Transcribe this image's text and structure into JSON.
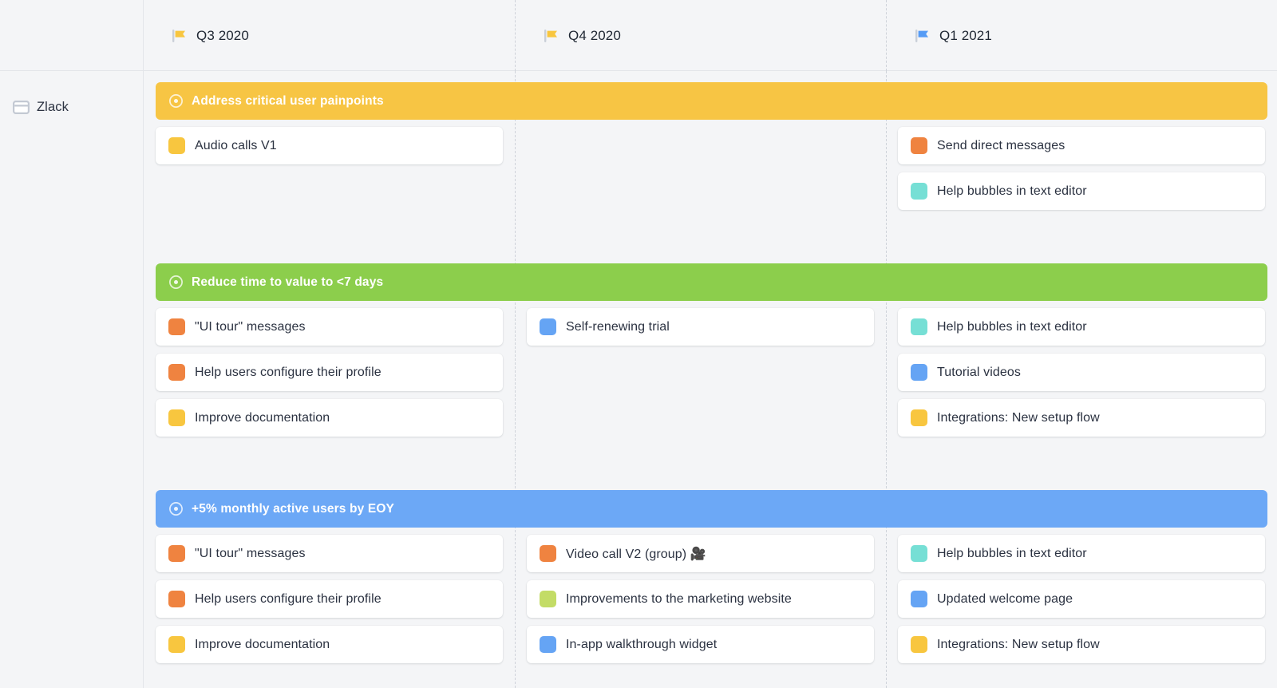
{
  "app": {
    "background": "#f4f5f7",
    "card_background": "#ffffff"
  },
  "sidebar": {
    "items": [
      {
        "label": "Zlack",
        "icon": "board-icon"
      }
    ]
  },
  "header": {
    "quarters": [
      {
        "label": "Q3 2020",
        "icon": "flag-icon",
        "flag_color": "#f8c63f"
      },
      {
        "label": "Q4 2020",
        "icon": "flag-icon",
        "flag_color": "#f8c63f"
      },
      {
        "label": "Q1 2021",
        "icon": "flag-icon",
        "flag_color": "#559bf5"
      }
    ]
  },
  "colors": {
    "goal_yellow": "#f7c544",
    "goal_green": "#8cce4c",
    "goal_blue": "#6ca8f6",
    "swatch_yellow": "#f8c63f",
    "swatch_orange": "#ef8340",
    "swatch_teal": "#76dfd5",
    "swatch_blue": "#65a4f4",
    "swatch_lime": "#c3dc66",
    "text": "#2b3241",
    "divider": "#e3e5e9",
    "dashed_divider": "#cfd3da"
  },
  "goals": [
    {
      "title": "Address critical user painpoints",
      "color": "#f7c544",
      "icon": "target-icon",
      "columns": [
        [
          {
            "label": "Audio calls V1",
            "color": "#f8c63f"
          }
        ],
        [],
        [
          {
            "label": "Send direct messages",
            "color": "#ef8340"
          },
          {
            "label": "Help bubbles in text editor",
            "color": "#76dfd5"
          }
        ]
      ]
    },
    {
      "title": "Reduce time to value to <7 days",
      "color": "#8cce4c",
      "icon": "target-icon",
      "columns": [
        [
          {
            "label": "\"UI tour\" messages",
            "color": "#ef8340"
          },
          {
            "label": "Help users configure their profile",
            "color": "#ef8340"
          },
          {
            "label": "Improve documentation",
            "color": "#f8c63f"
          }
        ],
        [
          {
            "label": "Self-renewing trial",
            "color": "#65a4f4"
          }
        ],
        [
          {
            "label": "Help bubbles in text editor",
            "color": "#76dfd5"
          },
          {
            "label": "Tutorial videos",
            "color": "#65a4f4"
          },
          {
            "label": "Integrations: New setup flow",
            "color": "#f8c63f"
          }
        ]
      ]
    },
    {
      "title": "+5% monthly active users by EOY",
      "color": "#6ca8f6",
      "icon": "target-icon",
      "columns": [
        [
          {
            "label": "\"UI tour\" messages",
            "color": "#ef8340"
          },
          {
            "label": "Help users configure their profile",
            "color": "#ef8340"
          },
          {
            "label": "Improve documentation",
            "color": "#f8c63f"
          }
        ],
        [
          {
            "label": "Video call V2 (group) 🎥",
            "color": "#ef8340"
          },
          {
            "label": "Improvements to the marketing website",
            "color": "#c3dc66"
          },
          {
            "label": "In-app walkthrough widget",
            "color": "#65a4f4"
          }
        ],
        [
          {
            "label": "Help bubbles in text editor",
            "color": "#76dfd5"
          },
          {
            "label": "Updated welcome page",
            "color": "#65a4f4"
          },
          {
            "label": "Integrations: New setup flow",
            "color": "#f8c63f"
          }
        ]
      ]
    }
  ]
}
